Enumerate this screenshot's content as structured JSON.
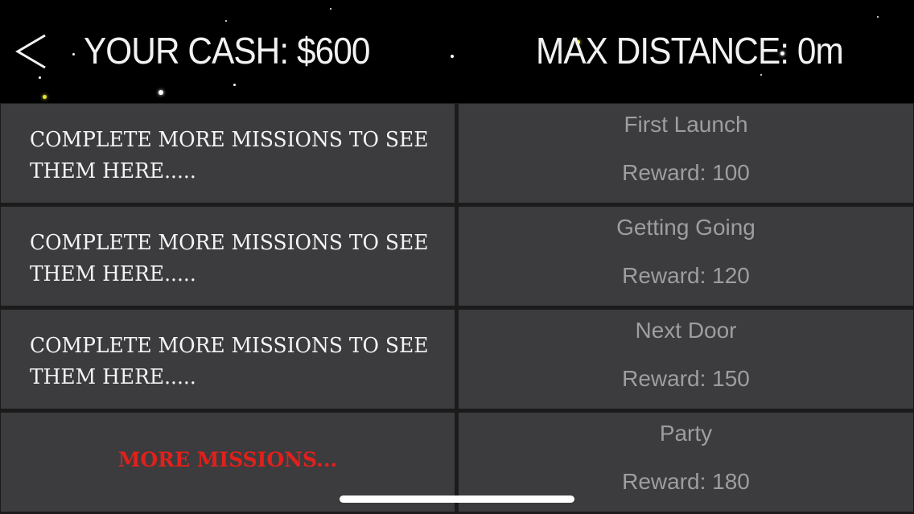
{
  "header": {
    "back_icon": "chevron-left-icon",
    "cash_text": "YOUR CASH: $600",
    "max_distance_text": "MAX DISTANCE: 0m"
  },
  "missions": {
    "locked_text": "COMPLETE MORE MISSIONS TO SEE THEM HERE.....",
    "more_missions_label": "MORE MISSIONS...",
    "more_missions_color": "#e0211b",
    "items": [
      {
        "name": "First Launch",
        "reward": "Reward: 100"
      },
      {
        "name": "Getting Going",
        "reward": "Reward: 120"
      },
      {
        "name": "Next Door",
        "reward": "Reward: 150"
      },
      {
        "name": "Party",
        "reward": "Reward: 180"
      }
    ]
  },
  "colors": {
    "background": "#000000",
    "cell": "#3c3b3e",
    "mission_text": "#9e9e9e"
  }
}
